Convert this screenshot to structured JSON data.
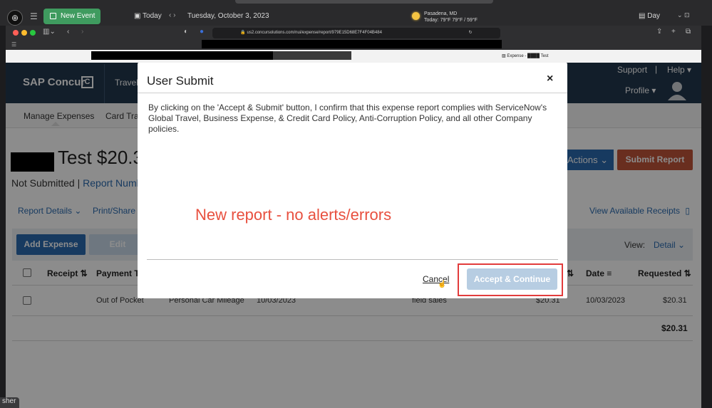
{
  "calendar_bar": {
    "new_event_label": "New Event",
    "today_label": "Today",
    "date": "Tuesday, October 3, 2023",
    "location": "Pasadena, MD",
    "weather": "Today: 79°F 79°F / 59°F",
    "view_label": "Day"
  },
  "browser": {
    "url": "us2.concursolutions.com/nui/expense/report/979E15D68E7F4F04B484",
    "tab_label": "Expense - ████ Test"
  },
  "concur": {
    "logo_text": "SAP Concur",
    "logo_mark": "C",
    "nav_travel": "Travel",
    "support": "Support",
    "help": "Help ▾",
    "profile": "Profile ▾",
    "subnav": [
      "Manage Expenses",
      "Card Tran"
    ],
    "report_title": "Test $20.3",
    "status_text": "Not Submitted |",
    "report_number_link": "Report Numb",
    "actions_label": "Actions ⌄",
    "submit_report_label": "Submit Report",
    "report_details_label": "Report Details ⌄",
    "print_share_label": "Print/Share ⌄",
    "view_receipts_label": "View Available Receipts",
    "add_expense_label": "Add Expense",
    "edit_label": "Edit",
    "view_label": "View:",
    "view_value": "Detail ⌄",
    "columns": {
      "receipt": "Receipt ⇅",
      "payment_type": "Payment Ty",
      "date": "Date ≡",
      "requested": "Requested ⇅",
      "sort": "⇅"
    },
    "row": {
      "payment_type": "Out of Pocket",
      "expense_type": "Personal Car Mileage",
      "transaction_date": "10/03/2023",
      "purpose": "field sales",
      "amount": "$20.31",
      "date": "10/03/2023",
      "requested": "$20.31"
    },
    "total": "$20.31"
  },
  "modal": {
    "title": "User Submit",
    "close": "×",
    "body": "By clicking on the 'Accept & Submit'  button, I confirm that this expense report complies with ServiceNow's Global Travel, Business Expense, & Credit Card Policy, Anti-Corruption Policy, and all other Company policies.",
    "cancel_label": "Cancel",
    "accept_label": "Accept & Continue"
  },
  "annotation": "New report  - no alerts/errors",
  "bottom_tab": "sher",
  "colors": {
    "concur_header": "#22374e",
    "primary_blue": "#2a6bb0",
    "submit_red": "#c0543a",
    "highlight_red": "#e23c3c",
    "annotation": "#e8503f"
  }
}
